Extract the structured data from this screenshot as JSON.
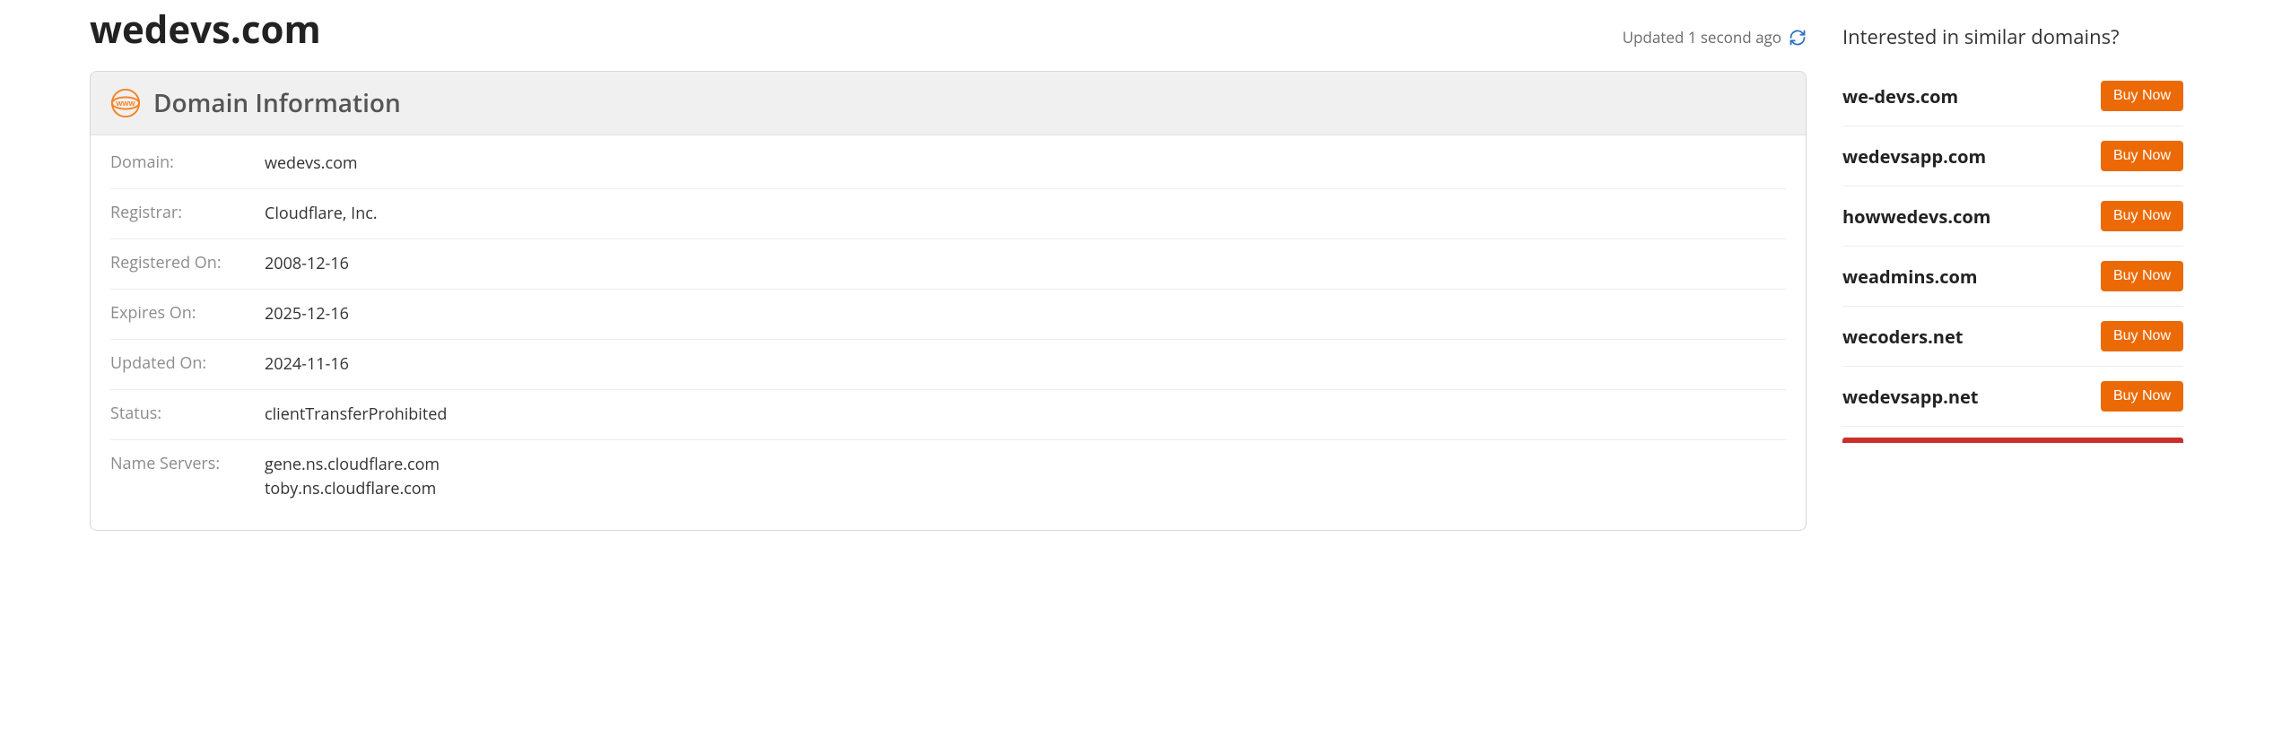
{
  "title": "wedevs.com",
  "updated_text": "Updated 1 second ago",
  "card": {
    "header": "Domain Information",
    "rows": [
      {
        "label": "Domain:",
        "value": "wedevs.com"
      },
      {
        "label": "Registrar:",
        "value": "Cloudflare, Inc."
      },
      {
        "label": "Registered On:",
        "value": "2008-12-16"
      },
      {
        "label": "Expires On:",
        "value": "2025-12-16"
      },
      {
        "label": "Updated On:",
        "value": "2024-11-16"
      },
      {
        "label": "Status:",
        "value": "clientTransferProhibited"
      },
      {
        "label": "Name Servers:",
        "value": "gene.ns.cloudflare.com\ntoby.ns.cloudflare.com"
      }
    ]
  },
  "sidebar": {
    "title": "Interested in similar domains?",
    "buy_label": "Buy Now",
    "items": [
      "we-devs.com",
      "wedevsapp.com",
      "howwedevs.com",
      "weadmins.com",
      "wecoders.net",
      "wedevsapp.net"
    ]
  },
  "colors": {
    "accent": "#ec6a05",
    "icon": "#f58220",
    "refresh": "#2f71c4"
  }
}
